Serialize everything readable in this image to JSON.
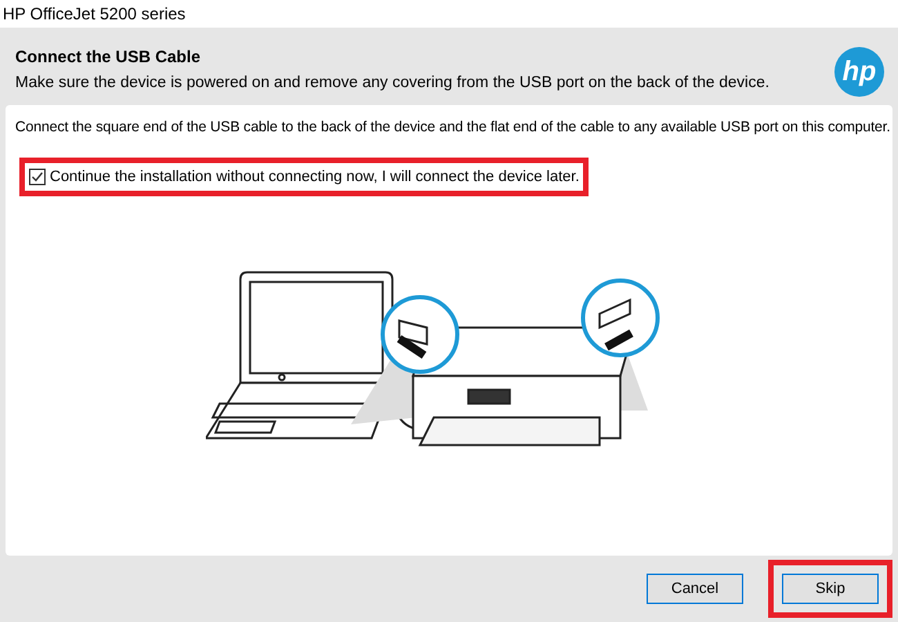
{
  "window": {
    "title": "HP OfficeJet 5200 series"
  },
  "header": {
    "title": "Connect the USB Cable",
    "subtitle": "Make sure the device is powered on and remove any covering from the USB port on the back of the device.",
    "logo": "hp"
  },
  "instruction": "Connect the square end of the USB cable to the back of the device and the flat end of the cable to any available USB port on this computer.",
  "option": {
    "label": "Continue the installation without connecting now, I will connect the device later.",
    "checked": true,
    "highlighted": true
  },
  "buttons": [
    {
      "label": "Cancel",
      "highlighted": false
    },
    {
      "label": "Skip",
      "highlighted": true
    }
  ]
}
